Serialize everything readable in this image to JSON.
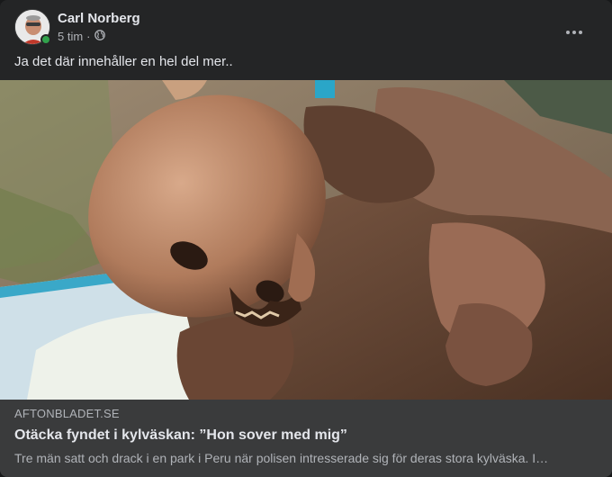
{
  "post": {
    "author": "Carl Norberg",
    "time": "5 tim",
    "separator": "·",
    "text": "Ja det där innehåller en hel del mer.."
  },
  "link": {
    "domain": "AFTONBLADET.SE",
    "title": "Otäcka fyndet i kylväskan: ”Hon sover med mig”",
    "description": "Tre män satt och drack i en park i Peru när polisen intresserade sig för deras stora kylväska. I…"
  },
  "icons": {
    "audience": "globe-icon",
    "menu": "more-options-icon",
    "status": "online-status-dot"
  },
  "colors": {
    "card_background": "#242526",
    "link_background": "#3a3b3c",
    "online": "#31a24c",
    "primary_text": "#e4e6eb",
    "secondary_text": "#b0b3b8"
  }
}
